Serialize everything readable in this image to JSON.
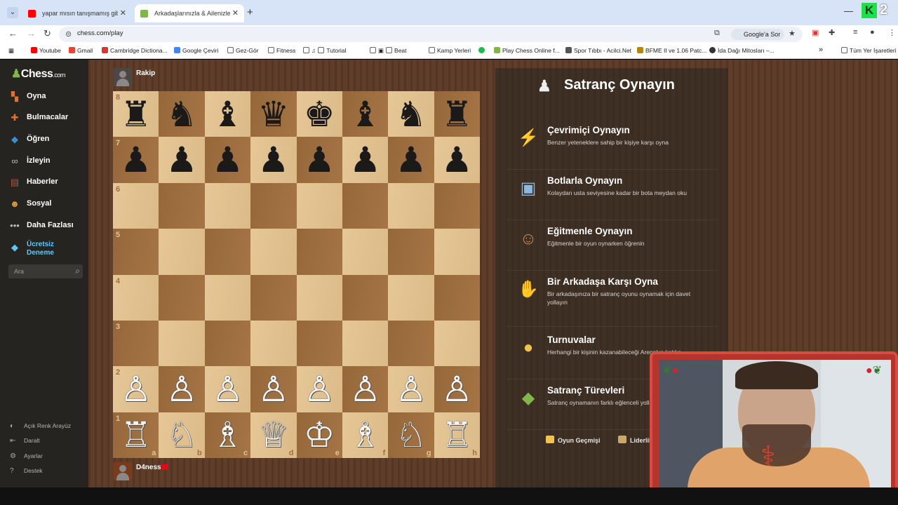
{
  "browser": {
    "tabs": [
      {
        "title": "yapar mısın tanışmamış gibi | p",
        "active": false,
        "favicon_color": "#ff0000"
      },
      {
        "title": "Arkadaşlarınızla & Ailenizle Üc",
        "active": true,
        "favicon_color": "#81b64c"
      }
    ],
    "new_tab": "+",
    "url": "chess.com/play",
    "google_sor": "Google'a Sor",
    "k_badge": "K",
    "k_count": "2",
    "bookmarks": [
      {
        "label": "Youtube",
        "color": "#ff0000"
      },
      {
        "label": "Gmail",
        "color": "#ea4335"
      },
      {
        "label": "Cambridge Dictiona...",
        "color": "#d33"
      },
      {
        "label": "Google Çeviri",
        "color": "#4285f4"
      },
      {
        "label": "Gez-Gör",
        "color": "#777"
      },
      {
        "label": "Fitness",
        "color": "#777"
      },
      {
        "label": "Tutorial",
        "color": "#777"
      },
      {
        "label": "Beat",
        "color": "#777"
      },
      {
        "label": "Kamp Yerleri",
        "color": "#777"
      },
      {
        "label": "",
        "color": "#1db954"
      },
      {
        "label": "Play Chess Online f...",
        "color": "#81b64c"
      },
      {
        "label": "Spor Tıbbı - Acilci.Net",
        "color": "#555"
      },
      {
        "label": "BFME II ve 1.06 Patc...",
        "color": "#b8860b"
      },
      {
        "label": "İda Dağı Mitosları –...",
        "color": "#333"
      }
    ],
    "all_bookmarks": "Tüm Yer İşaretleri"
  },
  "sidebar": {
    "logo": "Chess",
    "logo_suffix": ".com",
    "items": [
      {
        "label": "Oyna",
        "icon": "play-board-icon",
        "color": "#e8702a"
      },
      {
        "label": "Bulmacalar",
        "icon": "puzzle-icon",
        "color": "#e8702a"
      },
      {
        "label": "Öğren",
        "icon": "learn-icon",
        "color": "#3b8fd0"
      },
      {
        "label": "İzleyin",
        "icon": "binoculars-icon",
        "color": "#bbbbbb"
      },
      {
        "label": "Haberler",
        "icon": "news-icon",
        "color": "#d8453a"
      },
      {
        "label": "Sosyal",
        "icon": "social-icon",
        "color": "#e0a040"
      },
      {
        "label": "Daha Fazlası",
        "icon": "more-icon",
        "color": "#bbbbbb"
      }
    ],
    "trial_label_1": "Ücretsiz",
    "trial_label_2": "Deneme",
    "search_placeholder": "Ara",
    "footer": [
      {
        "label": "Açık Renk Arayüz",
        "icon": "contrast-icon"
      },
      {
        "label": "Daralt",
        "icon": "collapse-icon"
      },
      {
        "label": "Ayarlar",
        "icon": "gear-icon"
      },
      {
        "label": "Destek",
        "icon": "help-icon"
      }
    ]
  },
  "game": {
    "opponent": "Rakip",
    "me": "D4ness",
    "ranks": [
      "8",
      "7",
      "6",
      "5",
      "4",
      "3",
      "2",
      "1"
    ],
    "files": [
      "a",
      "b",
      "c",
      "d",
      "e",
      "f",
      "g",
      "h"
    ],
    "position": [
      [
        "♜",
        "♞",
        "♝",
        "♛",
        "♚",
        "♝",
        "♞",
        "♜"
      ],
      [
        "♟",
        "♟",
        "♟",
        "♟",
        "♟",
        "♟",
        "♟",
        "♟"
      ],
      [
        "",
        "",
        "",
        "",
        "",
        "",
        "",
        ""
      ],
      [
        "",
        "",
        "",
        "",
        "",
        "",
        "",
        ""
      ],
      [
        "",
        "",
        "",
        "",
        "",
        "",
        "",
        ""
      ],
      [
        "",
        "",
        "",
        "",
        "",
        "",
        "",
        ""
      ],
      [
        "♙",
        "♙",
        "♙",
        "♙",
        "♙",
        "♙",
        "♙",
        "♙"
      ],
      [
        "♖",
        "♘",
        "♗",
        "♕",
        "♔",
        "♗",
        "♘",
        "♖"
      ]
    ]
  },
  "panel": {
    "title": "Satranç Oynayın",
    "options": [
      {
        "title": "Çevrimiçi Oynayın",
        "desc": "Benzer yeteneklere sahip bir kişiye karşı oyna",
        "icon": "lightning-icon",
        "glyph": "⚡",
        "color": "#f5c518"
      },
      {
        "title": "Botlarla Oynayın",
        "desc": "Kolaydan usta seviyesine kadar bir bota meydan oku",
        "icon": "computer-icon",
        "glyph": "▣",
        "color": "#8fb8e0"
      },
      {
        "title": "Eğitmenle Oynayın",
        "desc": "Eğitmenle bir oyun oynarken öğrenin",
        "icon": "coach-icon",
        "glyph": "☺",
        "color": "#c58a5a"
      },
      {
        "title": "Bir Arkadaşa Karşı Oyna",
        "desc": "Bir arkadaşınıza bir satranç oyunu oynamak için davet yollayın",
        "icon": "handshake-icon",
        "glyph": "✋",
        "color": "#c8a27a"
      },
      {
        "title": "Turnuvalar",
        "desc": "Herhangi bir kişinin kazanabileceği Arena'ya katılın",
        "icon": "medal-icon",
        "glyph": "●",
        "color": "#f2c14e"
      },
      {
        "title": "Satranç Türevleri",
        "desc": "Satranç oynamanın farklı eğlenceli yollarını keşfedin",
        "icon": "variants-cube-icon",
        "glyph": "◆",
        "color": "#81b64c"
      }
    ],
    "links": [
      {
        "label": "Oyun Geçmişi",
        "color": "#f2c14e"
      },
      {
        "label": "Liderlik",
        "color": "#c9a86a"
      }
    ]
  }
}
